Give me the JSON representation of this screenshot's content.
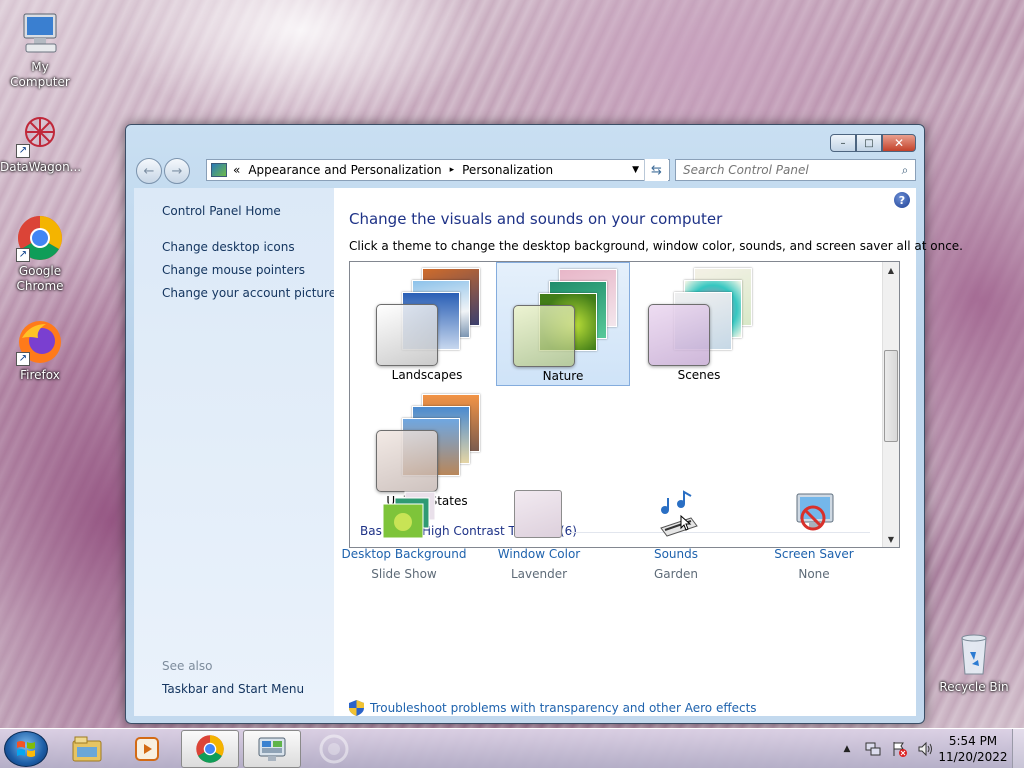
{
  "desktop": {
    "icons": [
      {
        "label": "My Computer",
        "icon": "computer-icon"
      },
      {
        "label": "DataWagon...",
        "icon": "datawagon-icon"
      },
      {
        "label": "Google Chrome",
        "icon": "chrome-icon"
      },
      {
        "label": "Firefox",
        "icon": "firefox-icon"
      },
      {
        "label": "Recycle Bin",
        "icon": "recycle-bin-icon"
      }
    ]
  },
  "window": {
    "controls": {
      "minimize": "–",
      "maximize": "□",
      "close": "✕"
    },
    "nav": {
      "back": "←",
      "forward": "→",
      "breadcrumb_sep": "«",
      "breadcrumb": [
        "Appearance and Personalization",
        "Personalization"
      ],
      "crumb_arrow": "▸",
      "dropdown": "▼",
      "refresh": "⇆"
    },
    "search": {
      "placeholder": "Search Control Panel",
      "icon": "⌕"
    },
    "left_pane": {
      "home": "Control Panel Home",
      "links": [
        "Change desktop icons",
        "Change mouse pointers",
        "Change your account picture"
      ],
      "see_also_title": "See also",
      "see_also_links": [
        "Taskbar and Start Menu"
      ]
    },
    "main": {
      "help": "?",
      "title": "Change the visuals and sounds on your computer",
      "subtitle": "Click a theme to change the desktop background, window color, sounds, and screen saver all at once.",
      "themes": [
        {
          "name": "Landscapes",
          "selected": false
        },
        {
          "name": "Nature",
          "selected": true
        },
        {
          "name": "Scenes",
          "selected": false
        },
        {
          "name": "United States",
          "selected": false
        }
      ],
      "group_header": "Basic and High Contrast Themes (6)",
      "settings": [
        {
          "label": "Desktop Background",
          "value": "Slide Show",
          "icon": "desktop-background-icon"
        },
        {
          "label": "Window Color",
          "value": "Lavender",
          "icon": "window-color-icon"
        },
        {
          "label": "Sounds",
          "value": "Garden",
          "icon": "sounds-icon"
        },
        {
          "label": "Screen Saver",
          "value": "None",
          "icon": "screen-saver-icon"
        }
      ],
      "troubleshoot": "Troubleshoot problems with transparency and other Aero effects"
    }
  },
  "taskbar": {
    "pinned": [
      "explorer-icon",
      "media-player-icon",
      "chrome-icon",
      "control-panel-icon",
      "disabled-app-icon"
    ],
    "tray": {
      "chevron": "▲",
      "time": "5:54 PM",
      "date": "11/20/2022"
    }
  },
  "colors": {
    "link": "#1e62ad",
    "title": "#1e3287",
    "selection": "#cfe3f8"
  }
}
